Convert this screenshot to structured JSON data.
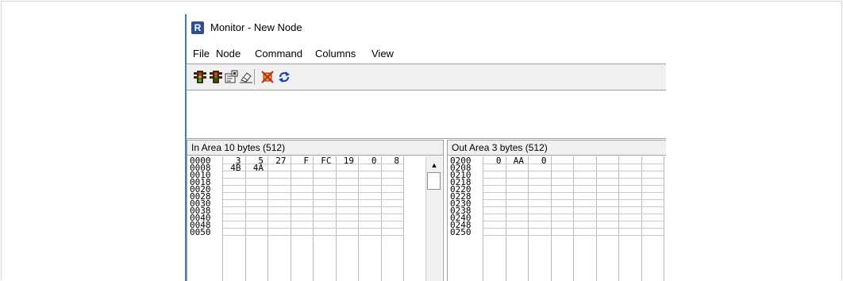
{
  "window": {
    "title": "Monitor - New Node",
    "icon": "R"
  },
  "menu": [
    "File",
    "Node",
    "Command",
    "Columns",
    "View"
  ],
  "toolbar": [
    "traffic-light-green-icon",
    "traffic-light-red-icon",
    "properties-icon",
    "erase-icon",
    "disconnect-icon",
    "refresh-icon"
  ],
  "in_area": {
    "header": "In Area 10 bytes (512)",
    "rows": [
      {
        "addr": "0000",
        "cells": [
          "3",
          "5",
          "27",
          "F",
          "FC",
          "19",
          "0",
          "8"
        ]
      },
      {
        "addr": "0008",
        "cells": [
          "4B",
          "4A",
          "",
          "",
          "",
          "",
          "",
          ""
        ]
      },
      {
        "addr": "0010",
        "cells": [
          "",
          "",
          "",
          "",
          "",
          "",
          "",
          ""
        ]
      },
      {
        "addr": "0018",
        "cells": [
          "",
          "",
          "",
          "",
          "",
          "",
          "",
          ""
        ]
      },
      {
        "addr": "0020",
        "cells": [
          "",
          "",
          "",
          "",
          "",
          "",
          "",
          ""
        ]
      },
      {
        "addr": "0028",
        "cells": [
          "",
          "",
          "",
          "",
          "",
          "",
          "",
          ""
        ]
      },
      {
        "addr": "0030",
        "cells": [
          "",
          "",
          "",
          "",
          "",
          "",
          "",
          ""
        ]
      },
      {
        "addr": "0038",
        "cells": [
          "",
          "",
          "",
          "",
          "",
          "",
          "",
          ""
        ]
      },
      {
        "addr": "0040",
        "cells": [
          "",
          "",
          "",
          "",
          "",
          "",
          "",
          ""
        ]
      },
      {
        "addr": "0048",
        "cells": [
          "",
          "",
          "",
          "",
          "",
          "",
          "",
          ""
        ]
      },
      {
        "addr": "0050",
        "cells": [
          "",
          "",
          "",
          "",
          "",
          "",
          "",
          ""
        ]
      }
    ]
  },
  "out_area": {
    "header": "Out Area 3 bytes (512)",
    "rows": [
      {
        "addr": "0200",
        "cells": [
          "0",
          "AA",
          "0",
          "",
          "",
          "",
          "",
          ""
        ]
      },
      {
        "addr": "0208",
        "cells": [
          "",
          "",
          "",
          "",
          "",
          "",
          "",
          ""
        ]
      },
      {
        "addr": "0210",
        "cells": [
          "",
          "",
          "",
          "",
          "",
          "",
          "",
          ""
        ]
      },
      {
        "addr": "0218",
        "cells": [
          "",
          "",
          "",
          "",
          "",
          "",
          "",
          ""
        ]
      },
      {
        "addr": "0220",
        "cells": [
          "",
          "",
          "",
          "",
          "",
          "",
          "",
          ""
        ]
      },
      {
        "addr": "0228",
        "cells": [
          "",
          "",
          "",
          "",
          "",
          "",
          "",
          ""
        ]
      },
      {
        "addr": "0230",
        "cells": [
          "",
          "",
          "",
          "",
          "",
          "",
          "",
          ""
        ]
      },
      {
        "addr": "0238",
        "cells": [
          "",
          "",
          "",
          "",
          "",
          "",
          "",
          ""
        ]
      },
      {
        "addr": "0240",
        "cells": [
          "",
          "",
          "",
          "",
          "",
          "",
          "",
          ""
        ]
      },
      {
        "addr": "0248",
        "cells": [
          "",
          "",
          "",
          "",
          "",
          "",
          "",
          ""
        ]
      },
      {
        "addr": "0250",
        "cells": [
          "",
          "",
          "",
          "",
          "",
          "",
          "",
          ""
        ]
      }
    ]
  }
}
